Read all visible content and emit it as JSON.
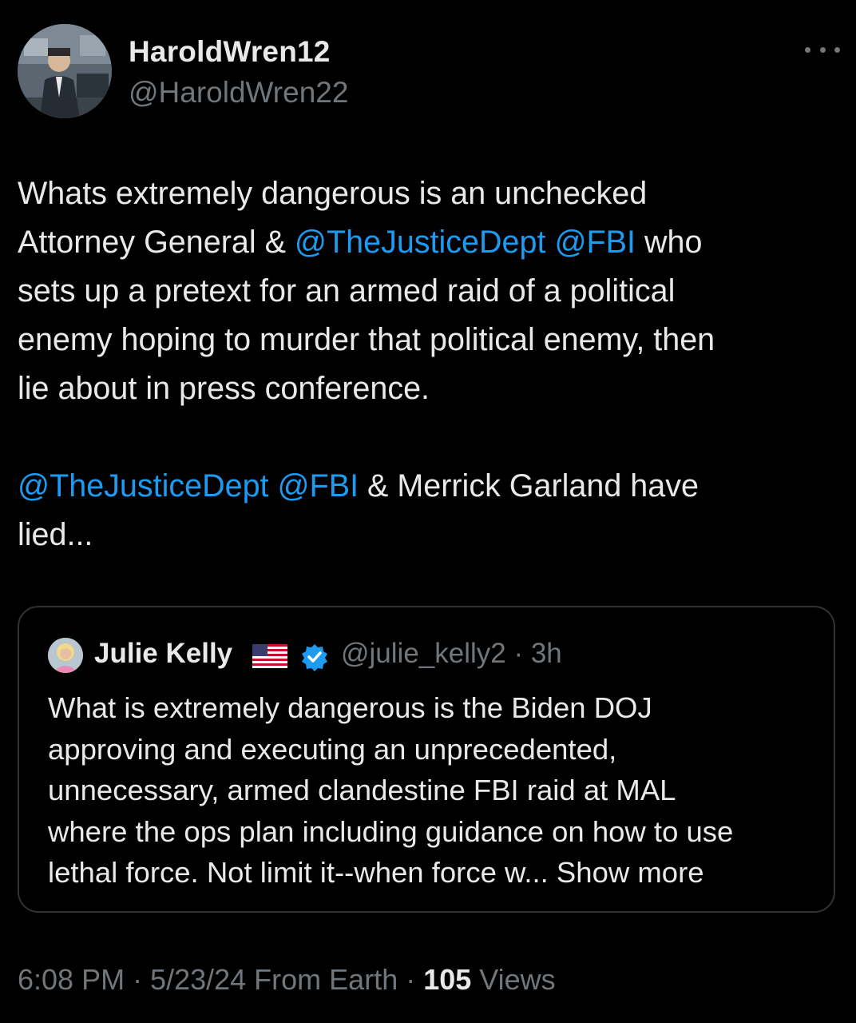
{
  "author": {
    "display_name": "HaroldWren12",
    "handle": "@HaroldWren22",
    "avatar_icon": "profile-photo"
  },
  "tweet": {
    "text_parts": [
      {
        "text": "Whats extremely dangerous is an unchecked\nAttorney General & ",
        "mention": false
      },
      {
        "text": "@TheJusticeDept",
        "mention": true
      },
      {
        "text": " ",
        "mention": false
      },
      {
        "text": "@FBI",
        "mention": true
      },
      {
        "text": " who\nsets up a pretext for an armed raid of a political\nenemy hoping to murder that political enemy, then\nlie about in press conference.\n\n",
        "mention": false
      },
      {
        "text": "@TheJusticeDept",
        "mention": true
      },
      {
        "text": " ",
        "mention": false
      },
      {
        "text": "@FBI",
        "mention": true
      },
      {
        "text": " & Merrick Garland have\nlied...",
        "mention": false
      }
    ]
  },
  "quote": {
    "display_name": "Julie Kelly",
    "flag_icon": "us-flag-icon",
    "verified_icon": "verified-badge-icon",
    "handle_time": "@julie_kelly2 · 3h",
    "text": "What is extremely dangerous is the Biden DOJ\napproving and executing an unprecedented,\nunnecessary, armed clandestine FBI raid at MAL\nwhere the ops plan including guidance on how to use\nlethal force. Not limit it--when force w... Show more"
  },
  "meta": {
    "time_date": "6:08 PM · 5/23/24 From Earth · ",
    "views_count": "105",
    "views_label": " Views"
  },
  "colors": {
    "background": "#000000",
    "text": "#e7e9ea",
    "secondary": "#71767b",
    "link": "#1d9bf0",
    "border": "#2f3336"
  }
}
